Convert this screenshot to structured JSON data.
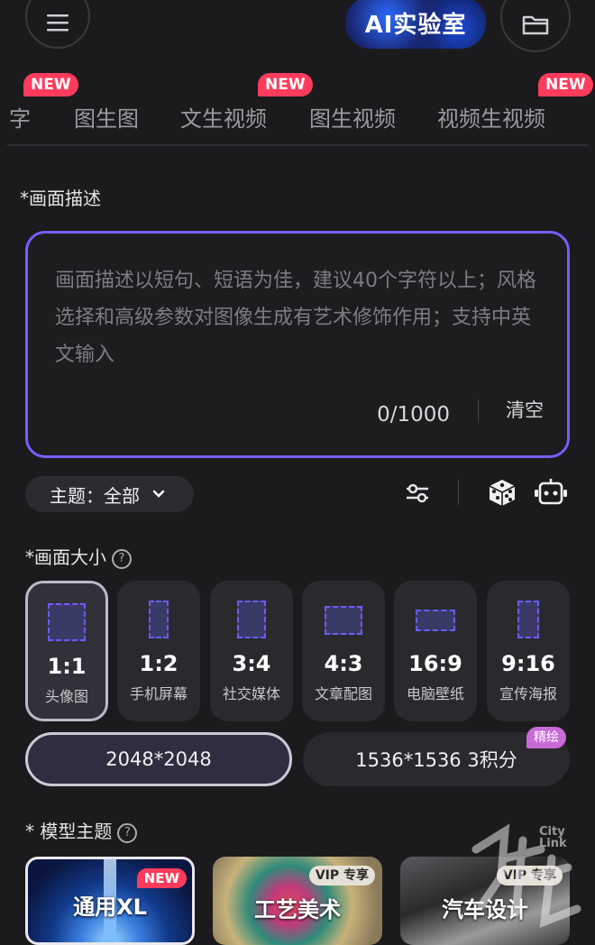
{
  "header": {
    "title": "AI实验室",
    "menu_icon": "menu-icon",
    "folder_icon": "folder-icon"
  },
  "tabs": [
    {
      "label": "字",
      "new": false
    },
    {
      "label": "图生图",
      "new": false
    },
    {
      "label": "文生视频",
      "new": true
    },
    {
      "label": "图生视频",
      "new": false
    },
    {
      "label": "视频生视频",
      "new": true
    }
  ],
  "new_badge": "NEW",
  "prompt": {
    "label": "*画面描述",
    "placeholder": "画面描述以短句、短语为佳，建议40个字符以上；风格选择和高级参数对图像生成有艺术修饰作用；支持中英文输入",
    "counter": "0/1000",
    "clear": "清空"
  },
  "theme": {
    "label": "主题：全部"
  },
  "size": {
    "label": "*画面大小",
    "help": "?",
    "options": [
      {
        "ratio": "1:1",
        "name": "头像图",
        "active": true
      },
      {
        "ratio": "1:2",
        "name": "手机屏幕",
        "active": false
      },
      {
        "ratio": "3:4",
        "name": "社交媒体",
        "active": false
      },
      {
        "ratio": "4:3",
        "name": "文章配图",
        "active": false
      },
      {
        "ratio": "16:9",
        "name": "电脑壁纸",
        "active": false
      },
      {
        "ratio": "9:16",
        "name": "宣传海报",
        "active": false
      }
    ]
  },
  "resolution": {
    "standard": "2048*2048",
    "fine": "1536*1536 3积分",
    "fine_badge": "精绘"
  },
  "model": {
    "label": "* 模型主题",
    "help": "?",
    "cards": [
      {
        "name": "通用XL",
        "badge": "NEW"
      },
      {
        "name": "工艺美术",
        "badge": "VIP 专享"
      },
      {
        "name": "汽车设计",
        "badge": "VIP 专享"
      }
    ]
  },
  "watermark": {
    "text": "City Link"
  },
  "colors": {
    "accent": "#7a5cff",
    "new_badge": "#ff3b5c",
    "fine_badge": "#c86bd6"
  }
}
